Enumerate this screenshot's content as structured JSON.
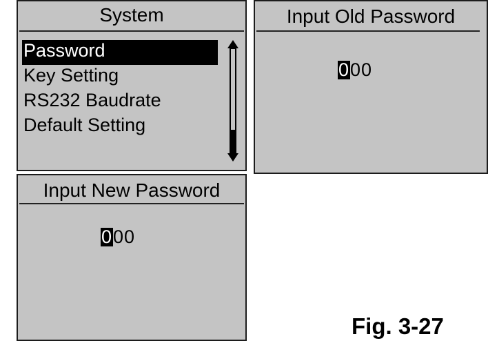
{
  "system_menu": {
    "title": "System",
    "items": [
      {
        "label": "Password",
        "selected": true
      },
      {
        "label": "Key Setting",
        "selected": false
      },
      {
        "label": "RS232 Baudrate",
        "selected": false
      },
      {
        "label": "Default Setting",
        "selected": false
      }
    ],
    "scroll_position_fraction": 0.85
  },
  "old_password_screen": {
    "title": "Input Old Password",
    "cursor_digit": "0",
    "remaining_digits": "00"
  },
  "new_password_screen": {
    "title": "Input New Password",
    "cursor_digit": "0",
    "remaining_digits": "00"
  },
  "figure": {
    "caption": "Fig. 3-27"
  },
  "colors": {
    "lcd_background": "#c4c4c4",
    "highlight": "#000000",
    "highlight_text": "#ffffff"
  },
  "icons": {
    "scroll_up": "triangle-up-icon",
    "scroll_down": "triangle-down-icon"
  }
}
